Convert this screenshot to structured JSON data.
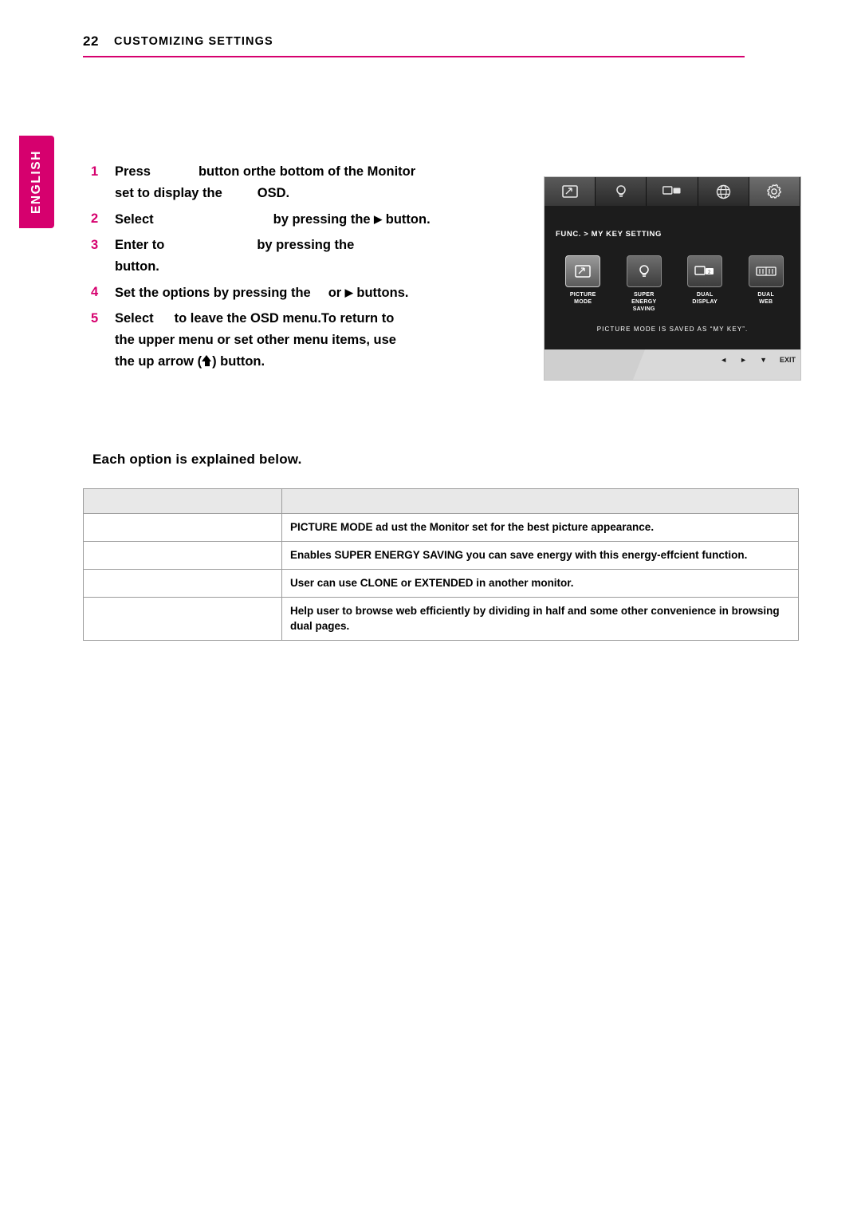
{
  "header": {
    "page_number": "22",
    "title": "CUSTOMIZING SETTINGS"
  },
  "language_tab": {
    "label": "ENGLISH"
  },
  "steps": [
    {
      "num": "1",
      "part1": "Press",
      "part2": "button orthe bottom of the Monitor",
      "part3": "set to display the",
      "part4": "OSD."
    },
    {
      "num": "2",
      "part1": "Select",
      "part2": "by pressing the",
      "arrow": "▶",
      "part3": "button."
    },
    {
      "num": "3",
      "part1": "Enter to",
      "part2": "by pressing the",
      "part3": "button."
    },
    {
      "num": "4",
      "part1": "Set the options by pressing the",
      "part2": "or",
      "arrow": "▶",
      "part3": "buttons."
    },
    {
      "num": "5",
      "part1": "Select",
      "part2": "to leave the OSD menu.To return to",
      "part3": "the upper menu or set other menu items, use",
      "part4": "the up arrow (",
      "part5": ") button."
    }
  ],
  "each_option_heading": "Each option is explained below.",
  "table": {
    "rows": [
      {
        "label": "",
        "desc": ""
      },
      {
        "label": "",
        "desc": "PICTURE MODE ad    ust the Monitor set for the best picture appearance."
      },
      {
        "label": "",
        "desc": "Enables SUPER ENERGY SAVING you can save energy with this energy-effcient function."
      },
      {
        "label": "",
        "desc": "User can use CLONE or EXTENDED in another monitor."
      },
      {
        "label": "",
        "desc": "Help user to browse web efficiently by dividing in half and some other convenience in browsing dual pages."
      }
    ]
  },
  "osd": {
    "breadcrumb": "FUNC.  >  MY KEY SETTING",
    "items": [
      {
        "caption1": "PICTURE",
        "caption2": "MODE",
        "caption3": ""
      },
      {
        "caption1": "SUPER",
        "caption2": "ENERGY",
        "caption3": "SAVING"
      },
      {
        "caption1": "DUAL",
        "caption2": "DISPLAY",
        "caption3": ""
      },
      {
        "caption1": "DUAL",
        "caption2": "WEB",
        "caption3": ""
      }
    ],
    "note": "PICTURE MODE IS SAVED AS “MY KEY”.",
    "footer": {
      "left_arrow": "◄",
      "right_arrow": "►",
      "down_arrow": "▼",
      "exit_label": "EXIT"
    }
  }
}
